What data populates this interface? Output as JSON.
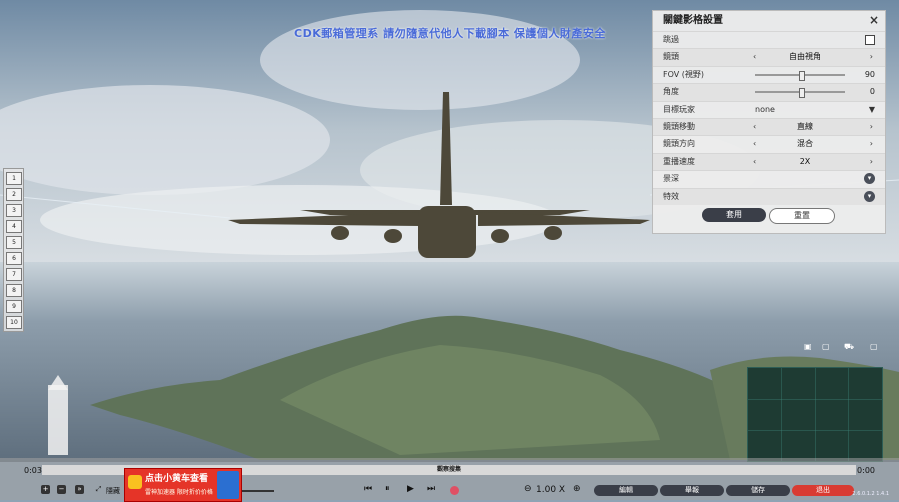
{
  "banner_text": "CDK郵箱管理系 請勿隨意代他人下載腳本 保護個人財產安全",
  "panel": {
    "title": "關鍵影格設置",
    "close_label": "×",
    "rows": {
      "skip": {
        "label": "跳過"
      },
      "camera": {
        "label": "鏡頭",
        "value": "自由視角"
      },
      "fov": {
        "label": "FOV (視野)",
        "value": "90",
        "level": 0.5
      },
      "angle": {
        "label": "角度",
        "value": "0",
        "level": 0.5
      },
      "target": {
        "label": "目標玩家",
        "value": "none"
      },
      "cam_move": {
        "label": "鏡頭移動",
        "value": "直線"
      },
      "cam_dir": {
        "label": "鏡頭方向",
        "value": "混合"
      },
      "speed": {
        "label": "重播速度",
        "value": "2X"
      },
      "dof": {
        "label": "景深"
      },
      "effects": {
        "label": "特效"
      }
    },
    "apply_label": "套用",
    "reset_label": "重置"
  },
  "left_buttons": [
    "1",
    "2",
    "3",
    "4",
    "5",
    "6",
    "7",
    "8",
    "9",
    "10"
  ],
  "timeline": {
    "time_start": "0:03",
    "time_end": "0:00",
    "track_label": "觀察搜集",
    "hide_label": "隱藏",
    "rate_value": "1.00",
    "rate_unit": "X",
    "edit_label": "編輯",
    "report_label": "舉報",
    "save_label": "儲存",
    "exit_label": "退出",
    "version": "2.6.0.1.2 1.4.1"
  },
  "ad": {
    "title": "点击小黄车查看",
    "subtitle": "雷神加速器 限时折价价格"
  },
  "colors": {
    "accent_dark": "#3a3e48",
    "exit_red": "#d93b32",
    "banner_blue": "#4a6bd8"
  }
}
